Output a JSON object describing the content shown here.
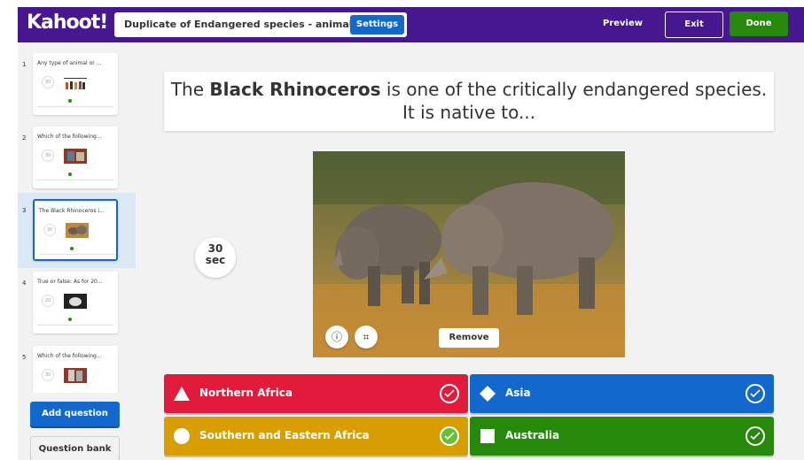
{
  "header": {
    "logo": "Kahoot!",
    "title": "Duplicate of Endangered species - animals",
    "settings_label": "Settings",
    "preview_label": "Preview",
    "exit_label": "Exit",
    "done_label": "Done"
  },
  "sidebar": {
    "slides": [
      {
        "num": "1",
        "title": "Any type of animal or ...",
        "time": "30"
      },
      {
        "num": "2",
        "title": "Which of the following...",
        "time": "30"
      },
      {
        "num": "3",
        "title": "The Black Rhinoceros i...",
        "time": "30"
      },
      {
        "num": "4",
        "title": "True or false: As for 20...",
        "time": "20"
      },
      {
        "num": "5",
        "title": "Which of the following...",
        "time": "30"
      }
    ],
    "add_question_label": "Add question",
    "question_bank_label": "Question bank"
  },
  "question": {
    "text_before": "The ",
    "text_bold": "Black Rhinoceros",
    "text_after": " is one of the critically endangered species. It is native to...",
    "timer_value": "30",
    "timer_unit": "sec",
    "remove_label": "Remove"
  },
  "answers": [
    {
      "text": "Northern Africa",
      "color": "#e21b3c",
      "shape": "triangle-icon",
      "correct": false
    },
    {
      "text": "Asia",
      "color": "#1368ce",
      "shape": "diamond-icon",
      "correct": false
    },
    {
      "text": "Southern and Eastern Africa",
      "color": "#d89e00",
      "shape": "circle-icon",
      "correct": true
    },
    {
      "text": "Australia",
      "color": "#26890c",
      "shape": "square-icon",
      "correct": false
    }
  ]
}
